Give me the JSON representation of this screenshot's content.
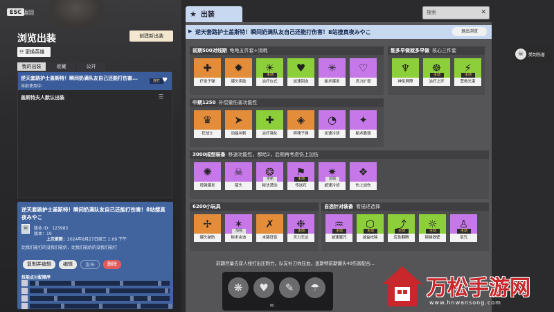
{
  "topbar": {
    "esc": "ESC",
    "back": "返回"
  },
  "left": {
    "title": "浏览出装",
    "create_button": "创建新出装",
    "hero_button": "更换英雄",
    "tabs": [
      "我的出装",
      "收藏",
      "公开"
    ],
    "selected_build": {
      "title": "逆天套路护士盖斯特！瞬间奶满队友自己还能打伤害...",
      "status": "当前使用中",
      "badge": "连打"
    },
    "default_build": "盖斯特夫人默认出装"
  },
  "detail": {
    "title": "逆天套路护士盖斯特！瞬间奶满队友自己还能打伤害！8站搜真夜みやこ",
    "version_id": "版本 ID：123983",
    "version": "版本：19",
    "updated_label": "上次更新：",
    "updated_value": "2024年8月27日周三 1:09 下午",
    "desc": "比我们能打的没我们能奶，比我们能奶的没我们能打",
    "buttons": [
      "复制并编辑",
      "编辑",
      "发布",
      "删除"
    ],
    "skill_order_label": "技能点分配顺序"
  },
  "main": {
    "tab_label": "出装",
    "search_placeholder": "搜索",
    "header_title": "逆天套路护士盖斯特！瞬间奶满队友自己还能打伤害！8站搜真夜みやこ",
    "exit_button": "退出浏览",
    "sections": [
      {
        "title": "前期500对线期",
        "subtitle": "龟龟五件套+消耗",
        "items": [
          {
            "name": "疗愈子弹",
            "color": "orange",
            "icon": "heal-bullet-icon",
            "glyph": "✚"
          },
          {
            "name": "爆头奖励",
            "color": "orange",
            "icon": "headshot-icon",
            "glyph": "✹"
          },
          {
            "name": "治疗仪式",
            "color": "green",
            "icon": "ritual-icon",
            "glyph": "☀",
            "tag": "主动"
          },
          {
            "name": "加速回血",
            "color": "green",
            "icon": "regen-icon",
            "glyph": "♥"
          },
          {
            "name": "秘术爆发",
            "color": "purple",
            "icon": "burst-icon",
            "glyph": "✳"
          },
          {
            "name": "灵力扩增",
            "color": "purple",
            "icon": "spirit-icon",
            "glyph": "♡"
          }
        ]
      },
      {
        "title": "能多早做就多早做",
        "subtitle": "核心三件套",
        "items": [
          {
            "name": "神圣屏障",
            "color": "green",
            "icon": "barrier-icon",
            "glyph": "♆"
          },
          {
            "name": "治疗之环",
            "color": "green",
            "icon": "heal-ring-icon",
            "glyph": "☸",
            "tag": "主动"
          },
          {
            "name": "营救光束",
            "color": "green",
            "icon": "rescue-beam-icon",
            "glyph": "⚡",
            "tag": "主动"
          }
        ]
      },
      {
        "title": "中期1250",
        "subtitle": "补偿量伤害功能性",
        "items": [
          {
            "name": "狂战士",
            "color": "orange",
            "icon": "berserker-icon",
            "glyph": "♛"
          },
          {
            "name": "动能冲刺",
            "color": "orange",
            "icon": "dash-icon",
            "glyph": "➤"
          },
          {
            "name": "治疗强化",
            "color": "green",
            "icon": "heal-boost-icon",
            "glyph": "✚"
          },
          {
            "name": "碎魂子弹",
            "color": "orange",
            "icon": "soul-bullet-icon",
            "glyph": "◈"
          },
          {
            "name": "加速冷却",
            "color": "purple",
            "icon": "cooldown-icon",
            "glyph": "◔"
          },
          {
            "name": "秘术脆弱",
            "color": "purple",
            "icon": "vulnerable-icon",
            "glyph": "✦"
          }
        ]
      },
      {
        "title": "3000成型装备",
        "subtitle": "移速功能性，都给2，后期再考虑伤上加伤",
        "items": [
          {
            "name": "增强爆发",
            "color": "purple",
            "icon": "burst-boost-icon",
            "glyph": "✺"
          },
          {
            "name": "猎头",
            "color": "purple",
            "icon": "headhunter-icon",
            "glyph": "☠"
          },
          {
            "name": "秘法涌动",
            "color": "purple",
            "icon": "surge-icon",
            "glyph": "❂",
            "tag": "全新",
            "tag_light": true
          },
          {
            "name": "传送石",
            "color": "purple",
            "icon": "teleport-icon",
            "glyph": "⚑",
            "tag": "主动"
          },
          {
            "name": "超速冷却",
            "color": "purple",
            "icon": "super-cooldown-icon",
            "glyph": "✷",
            "tag": "加强",
            "tag_light": true
          },
          {
            "name": "伤上加伤",
            "color": "purple",
            "icon": "amplify-icon",
            "glyph": "❖"
          }
        ]
      },
      {
        "title": "6200小玩具",
        "subtitle": "",
        "items": [
          {
            "name": "爆头破防",
            "color": "orange",
            "icon": "break-icon",
            "glyph": "✢"
          },
          {
            "name": "秘术余波",
            "color": "purple",
            "icon": "aftermath-icon",
            "glyph": "✶",
            "tag": "加强",
            "tag_light": true
          },
          {
            "name": "末路狂徒",
            "color": "orange",
            "icon": "outlaw-icon",
            "glyph": "✗"
          },
          {
            "name": "灵力无边",
            "color": "purple",
            "icon": "boundless-icon",
            "glyph": "❉",
            "tag": "主动"
          }
        ]
      },
      {
        "title": "自选针对装备",
        "subtitle": "看描述选择",
        "items": [
          {
            "name": "减速魔咒",
            "color": "purple",
            "icon": "slow-hex-icon",
            "glyph": "♒",
            "tag": "主动"
          },
          {
            "name": "减益祛除",
            "color": "green",
            "icon": "cleanse-icon",
            "glyph": "⬡",
            "tag": "主动"
          },
          {
            "name": "应急翻腾",
            "color": "green",
            "icon": "tumble-icon",
            "glyph": "⤴",
            "tag": "主动"
          },
          {
            "name": "钢锋铁壁",
            "color": "green",
            "icon": "steel-icon",
            "glyph": "☼",
            "tag": "主动"
          },
          {
            "name": "诅咒",
            "color": "purple",
            "icon": "curse-icon",
            "glyph": "♙",
            "tag": "主动"
          }
        ]
      }
    ],
    "footer": "前期尽量去双人线打出压制力，队友补刀你压血，盖斯特前期爆头40伤害配合..."
  },
  "float_button": {
    "label": "受到伤害"
  },
  "bottom_bar": {
    "slots": [
      "ability-1-icon",
      "ability-2-icon",
      "ability-3-icon",
      "ability-4-icon"
    ],
    "link": "∞"
  },
  "watermark": {
    "text": "万松手游网",
    "url": "www.hnwansong.com"
  },
  "colors": {
    "orange": "#e38c3a",
    "purple": "#c678e8",
    "green": "#8ccf3a",
    "blue": "#41649f"
  }
}
